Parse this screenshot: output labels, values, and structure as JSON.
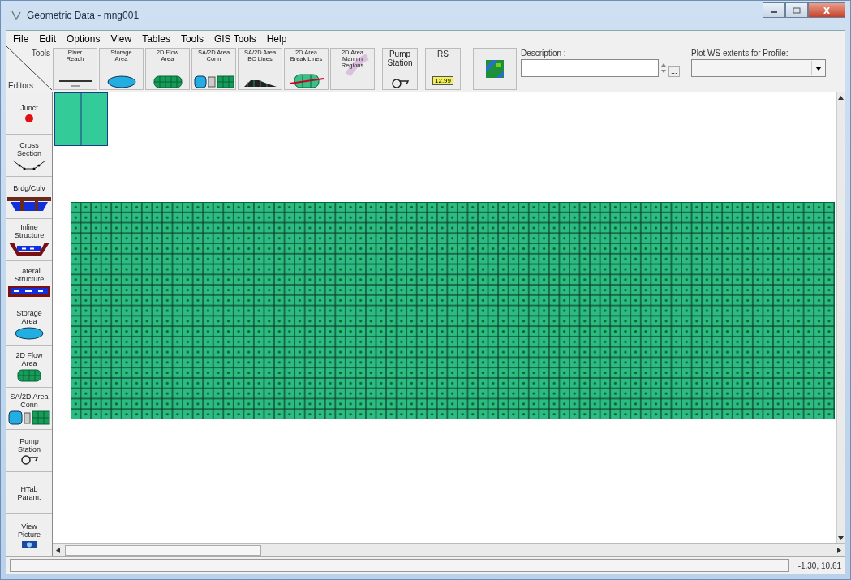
{
  "window": {
    "title": "Geometric Data - mng001"
  },
  "menu": [
    "File",
    "Edit",
    "Options",
    "View",
    "Tables",
    "Tools",
    "GIS Tools",
    "Help"
  ],
  "toolbar_corner": {
    "top": "Tools",
    "bottom": "Editors"
  },
  "toolbar": [
    {
      "label": "River\nReach",
      "kind": "reach"
    },
    {
      "label": "Storage\nArea",
      "kind": "storage"
    },
    {
      "label": "2D Flow\nArea",
      "kind": "flow2d"
    },
    {
      "label": "SA/2D Area\nConn",
      "kind": "conn"
    },
    {
      "label": "SA/2D Area\nBC Lines",
      "kind": "bc"
    },
    {
      "label": "2D Area\nBreak Lines",
      "kind": "breakline"
    },
    {
      "label": "2D Area\nMann n\nRegions",
      "kind": "mann"
    },
    {
      "label": "Pump\nStation",
      "kind": "pump"
    },
    {
      "label": "RS",
      "kind": "rs",
      "tag": "12.99"
    },
    {
      "kind": "map"
    }
  ],
  "description": {
    "label": "Description :",
    "more": "..."
  },
  "profile": {
    "label": "Plot WS extents for Profile:"
  },
  "sidebar": [
    {
      "label": "Junct",
      "kind": "junct"
    },
    {
      "label": "Cross\nSection",
      "kind": "xs"
    },
    {
      "label": "Brdg/Culv",
      "kind": "bridge"
    },
    {
      "label": "Inline\nStructure",
      "kind": "inline"
    },
    {
      "label": "Lateral\nStructure",
      "kind": "lateral"
    },
    {
      "label": "Storage\nArea",
      "kind": "storage"
    },
    {
      "label": "2D Flow\nArea",
      "kind": "flow2d"
    },
    {
      "label": "SA/2D Area\nConn",
      "kind": "conn"
    },
    {
      "label": "Pump\nStation",
      "kind": "pump"
    },
    {
      "label": "HTab\nParam.",
      "kind": "none"
    },
    {
      "label": "View\nPicture",
      "kind": "camera"
    }
  ],
  "status_bar": {
    "coordinates": "-1.30, 10.61"
  }
}
